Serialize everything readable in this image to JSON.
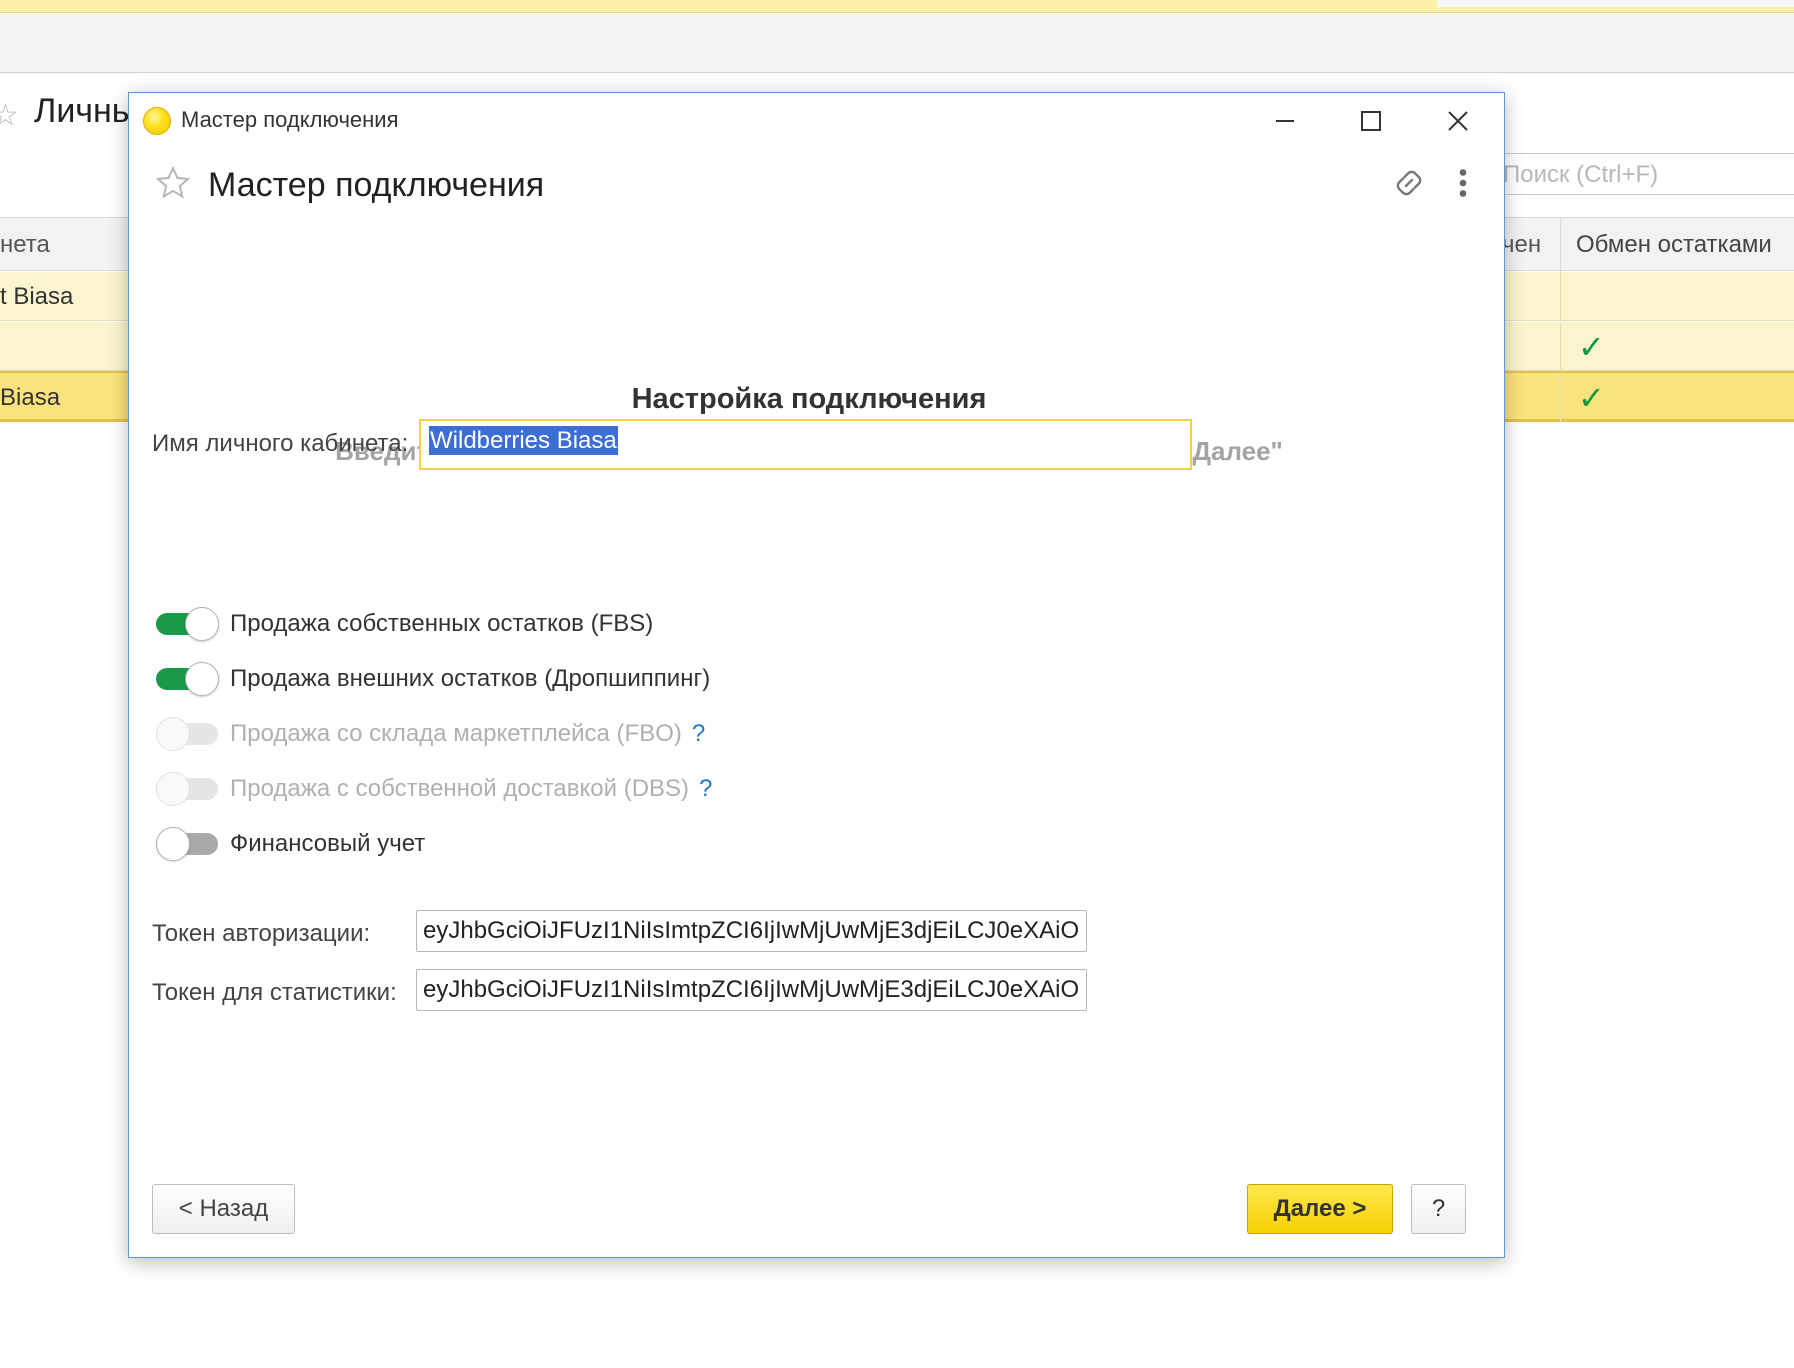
{
  "background": {
    "page_title": "Личнь",
    "search": {
      "placeholder": "Поиск (Ctrl+F)"
    },
    "table": {
      "header_left": "нета",
      "header_partial": "чен",
      "header_obmen": "Обмен остатками",
      "rows": [
        {
          "name": "t Biasa",
          "checked": false
        },
        {
          "name": "",
          "checked": true
        },
        {
          "name": "Biasa",
          "checked": true,
          "selected": true
        }
      ]
    },
    "check_mark": "✓"
  },
  "dialog": {
    "window_title": "Мастер подключения",
    "title": "Мастер подключения",
    "heading": "Настройка подключения",
    "subheading": "Введите настройки подключения к личному кабинету и нажмите \"Далее\"",
    "name_field": {
      "label": "Имя личного кабинета:",
      "value": "Wildberries Biasa"
    },
    "toggles": [
      {
        "label": "Продажа собственных остатков (FBS)",
        "state": "on"
      },
      {
        "label": "Продажа внешних остатков (Дропшиппинг)",
        "state": "on"
      },
      {
        "label": "Продажа со склада маркетплейса (FBO)",
        "state": "disabled",
        "help": "?"
      },
      {
        "label": "Продажа с собственной доставкой (DBS)",
        "state": "disabled",
        "help": "?"
      },
      {
        "label": "Финансовый учет",
        "state": "off"
      }
    ],
    "auth_token": {
      "label": "Токен авторизации:",
      "value": "eyJhbGciOiJFUzI1NiIsImtpZCI6IjIwMjUwMjE3djEiLCJ0eXAiO"
    },
    "stats_token": {
      "label": "Токен для статистики:",
      "value": "eyJhbGciOiJFUzI1NiIsImtpZCI6IjIwMjUwMjE3djEiLCJ0eXAiO"
    },
    "buttons": {
      "back": "< Назад",
      "next": "Далее >",
      "help": "?"
    }
  },
  "colors": {
    "accent_yellow": "#f6d200",
    "toggle_on": "#1a9a49",
    "link_blue": "#1f78c8",
    "window_border": "#5b9bd5"
  }
}
